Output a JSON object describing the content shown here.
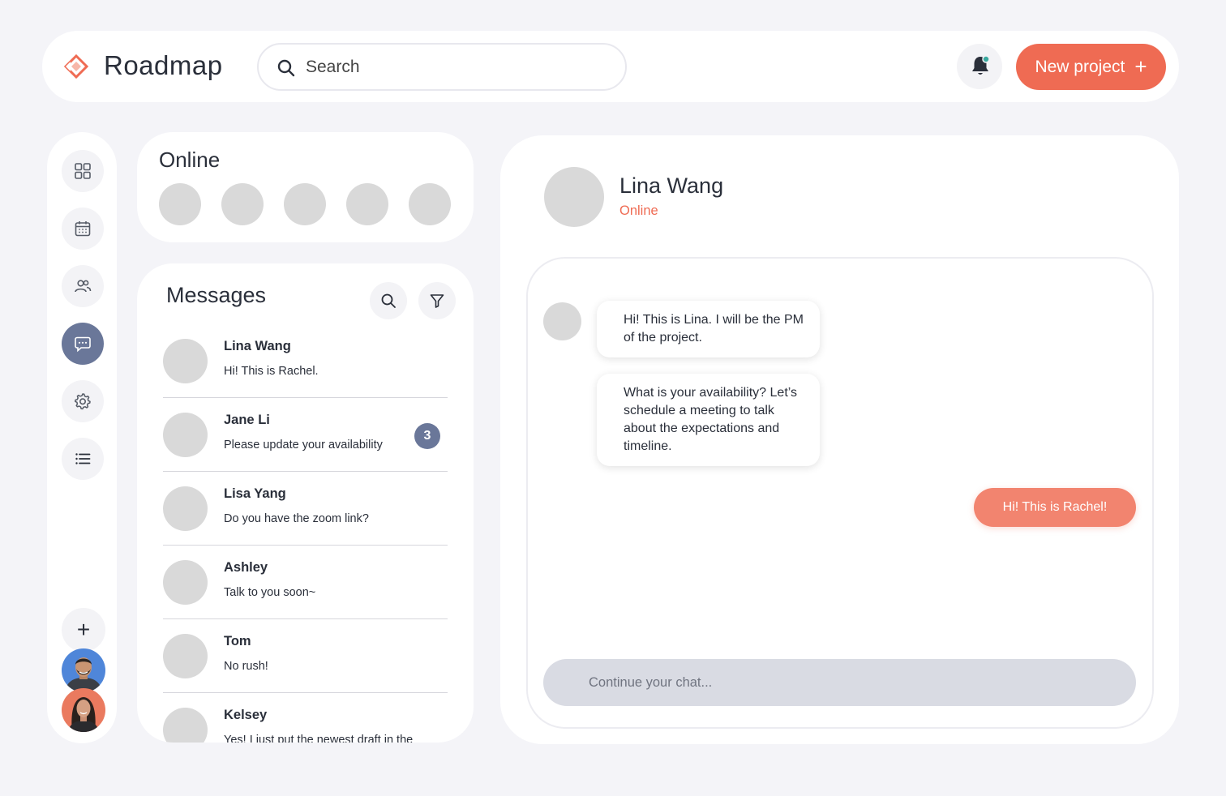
{
  "header": {
    "brand": "Roadmap",
    "search_placeholder": "Search",
    "new_project_label": "New project",
    "new_project_icon": "plus",
    "notification_icon": "bell-icon",
    "notification_dot_color": "#3aa99f"
  },
  "colors": {
    "accent": "#ef6b53",
    "nav_active": "#6a7799",
    "background": "#f4f4f8",
    "placeholder_avatar": "#d9d9d9"
  },
  "sidebar": {
    "items": [
      {
        "name": "dashboard",
        "icon": "grid-icon",
        "active": false
      },
      {
        "name": "calendar",
        "icon": "calendar-icon",
        "active": false
      },
      {
        "name": "team",
        "icon": "users-icon",
        "active": false
      },
      {
        "name": "messages",
        "icon": "chat-icon",
        "active": true
      },
      {
        "name": "settings",
        "icon": "gear-icon",
        "active": false
      },
      {
        "name": "list",
        "icon": "list-icon",
        "active": false
      }
    ],
    "add_label": "+"
  },
  "online": {
    "title": "Online",
    "count_shown": 5
  },
  "messages": {
    "title": "Messages",
    "conversations": [
      {
        "name": "Lina Wang",
        "preview": "Hi! This is Rachel.",
        "unread": ""
      },
      {
        "name": "Jane Li",
        "preview": "Please update your availability",
        "unread": "3"
      },
      {
        "name": "Lisa Yang",
        "preview": "Do you have the zoom link?",
        "unread": ""
      },
      {
        "name": "Ashley",
        "preview": "Talk to you soon~",
        "unread": ""
      },
      {
        "name": "Tom",
        "preview": "No rush!",
        "unread": ""
      },
      {
        "name": "Kelsey",
        "preview": "Yes! I just put the newest draft in the",
        "unread": ""
      }
    ]
  },
  "chat": {
    "contact_name": "Lina Wang",
    "contact_status": "Online",
    "messages": [
      {
        "from": "them",
        "text": "Hi! This is Lina. I will be the PM of the project."
      },
      {
        "from": "them",
        "text": "What is your availability? Let’s schedule a meeting to talk about the expectations and timeline."
      },
      {
        "from": "me",
        "text": "Hi! This is Rachel!"
      }
    ],
    "input_placeholder": "Continue your chat..."
  }
}
